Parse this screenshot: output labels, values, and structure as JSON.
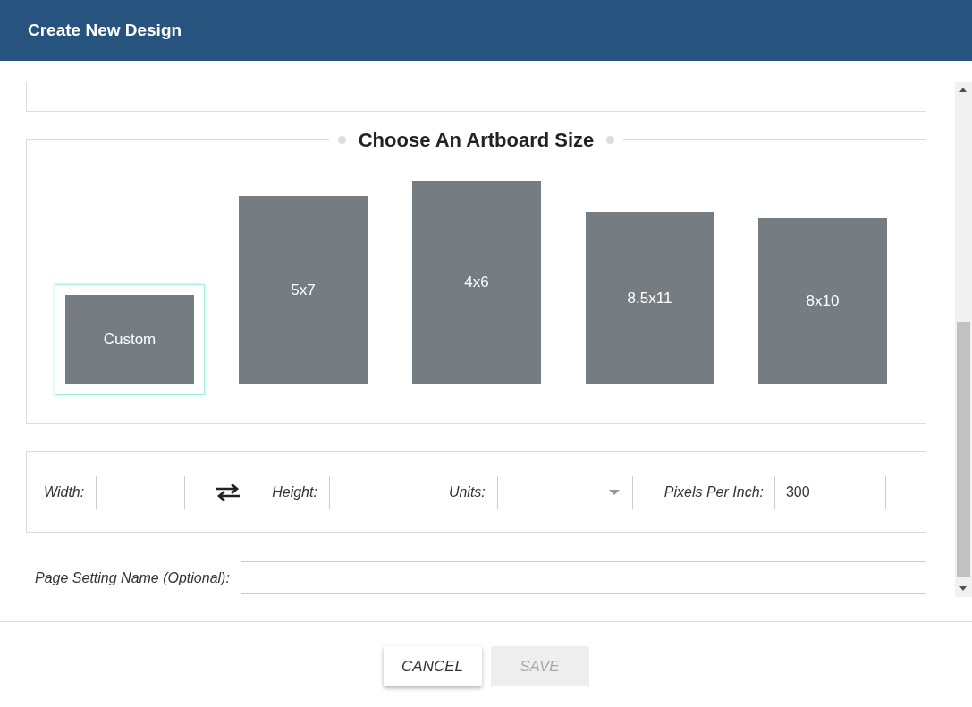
{
  "header": {
    "title": "Create New Design"
  },
  "artboard_section": {
    "title": "Choose An Artboard Size",
    "sizes": [
      {
        "label": "Custom",
        "selected": true
      },
      {
        "label": "5x7",
        "selected": false
      },
      {
        "label": "4x6",
        "selected": false
      },
      {
        "label": "8.5x11",
        "selected": false
      },
      {
        "label": "8x10",
        "selected": false
      }
    ]
  },
  "dimensions": {
    "width_label": "Width:",
    "height_label": "Height:",
    "units_label": "Units:",
    "ppi_label": "Pixels Per Inch:",
    "ppi_value": "300"
  },
  "page_setting": {
    "label": "Page Setting Name (Optional):"
  },
  "buttons": [
    {
      "label": "CANCEL",
      "disabled": false
    },
    {
      "label": "SAVE",
      "disabled": true
    }
  ]
}
